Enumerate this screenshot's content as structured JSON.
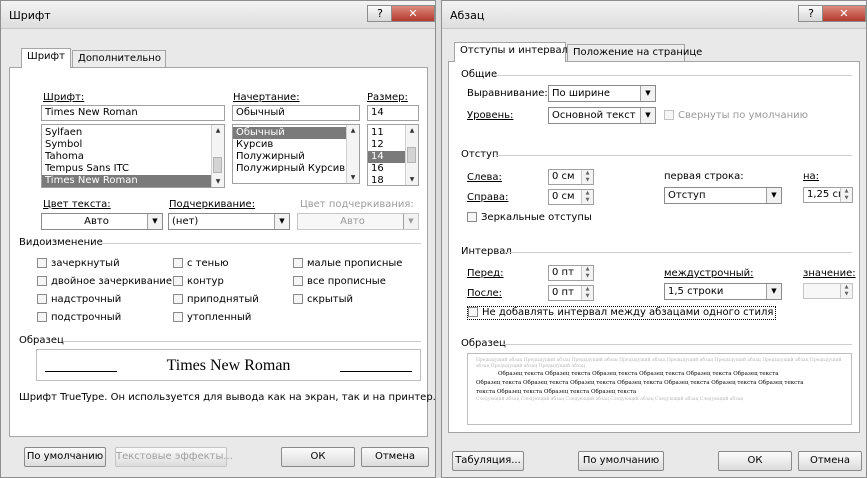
{
  "font_dialog": {
    "title": "Шрифт",
    "tabs": [
      "Шрифт",
      "Дополнительно"
    ],
    "font_label": "Шрифт:",
    "font_value": "Times New Roman",
    "font_list": [
      "Sylfaen",
      "Symbol",
      "Tahoma",
      "Tempus Sans ITC",
      "Times New Roman"
    ],
    "style_label": "Начертание:",
    "style_value": "Обычный",
    "style_list": [
      "Обычный",
      "Курсив",
      "Полужирный",
      "Полужирный Курсив"
    ],
    "size_label": "Размер:",
    "size_value": "14",
    "size_list": [
      "11",
      "12",
      "14",
      "16",
      "18"
    ],
    "text_color_label": "Цвет текста:",
    "text_color_value": "Авто",
    "underline_label": "Подчеркивание:",
    "underline_value": "(нет)",
    "underline_color_label": "Цвет подчеркивания:",
    "underline_color_value": "Авто",
    "effects_label": "Видоизменение",
    "effects": [
      [
        "зачеркнутый",
        "двойное зачеркивание",
        "надстрочный",
        "подстрочный"
      ],
      [
        "с тенью",
        "контур",
        "приподнятый",
        "утопленный"
      ],
      [
        "малые прописные",
        "все прописные",
        "скрытый"
      ]
    ],
    "sample_label": "Образец",
    "sample_text": "Times New Roman",
    "note": "Шрифт TrueType. Он используется для вывода как на экран, так и на принтер.",
    "btn_default": "По умолчанию",
    "btn_effects": "Текстовые эффекты...",
    "btn_ok": "ОК",
    "btn_cancel": "Отмена"
  },
  "para_dialog": {
    "title": "Абзац",
    "tabs": [
      "Отступы и интервалы",
      "Положение на странице"
    ],
    "general_label": "Общие",
    "align_label": "Выравнивание:",
    "align_value": "По ширине",
    "level_label": "Уровень:",
    "level_value": "Основной текст",
    "collapsed_label": "Свернуты по умолчанию",
    "indent_label": "Отступ",
    "left_label": "Слева:",
    "left_value": "0 см",
    "right_label": "Справа:",
    "right_value": "0 см",
    "first_line_label": "первая строка:",
    "first_line_value": "Отступ",
    "by_label": "на:",
    "by_value": "1,25 см",
    "mirror_label": "Зеркальные отступы",
    "spacing_label": "Интервал",
    "before_label": "Перед:",
    "before_value": "0 пт",
    "after_label": "После:",
    "after_value": "0 пт",
    "line_spacing_label": "междустрочный:",
    "line_spacing_value": "1,5 строки",
    "at_label": "значение:",
    "no_space_label": "Не добавлять интервал между абзацами одного стиля",
    "sample_label": "Образец",
    "sample_prev": "Предыдущий абзац Предыдущий абзац Предыдущий абзац Предыдущий абзац Предыдущий абзац Предыдущий абзац Предыдущий абзац Предыдущий абзац Предыдущий абзац Предыдущий абзац",
    "sample_lines": [
      "Образец текста Образец текста Образец текста Образец текста Образец текста Образец текста",
      "Образец текста Образец текста Образец текста Образец текста Образец текста Образец текста Образец текста",
      "текста Образец текста Образец текста Образец текста"
    ],
    "sample_next": "Следующий абзац Следующий абзац Следующий абзац Следующий абзац Следующий абзац Следующий абзац",
    "btn_tabs": "Табуляция...",
    "btn_default": "По умолчанию",
    "btn_ok": "ОК",
    "btn_cancel": "Отмена"
  },
  "window_controls": {
    "help": "?",
    "close": "✕"
  },
  "colors": {
    "selection": "#7a7a7a",
    "close_button": "#c0463a",
    "panel": "#ffffff",
    "dialog": "#e9e9e9"
  }
}
